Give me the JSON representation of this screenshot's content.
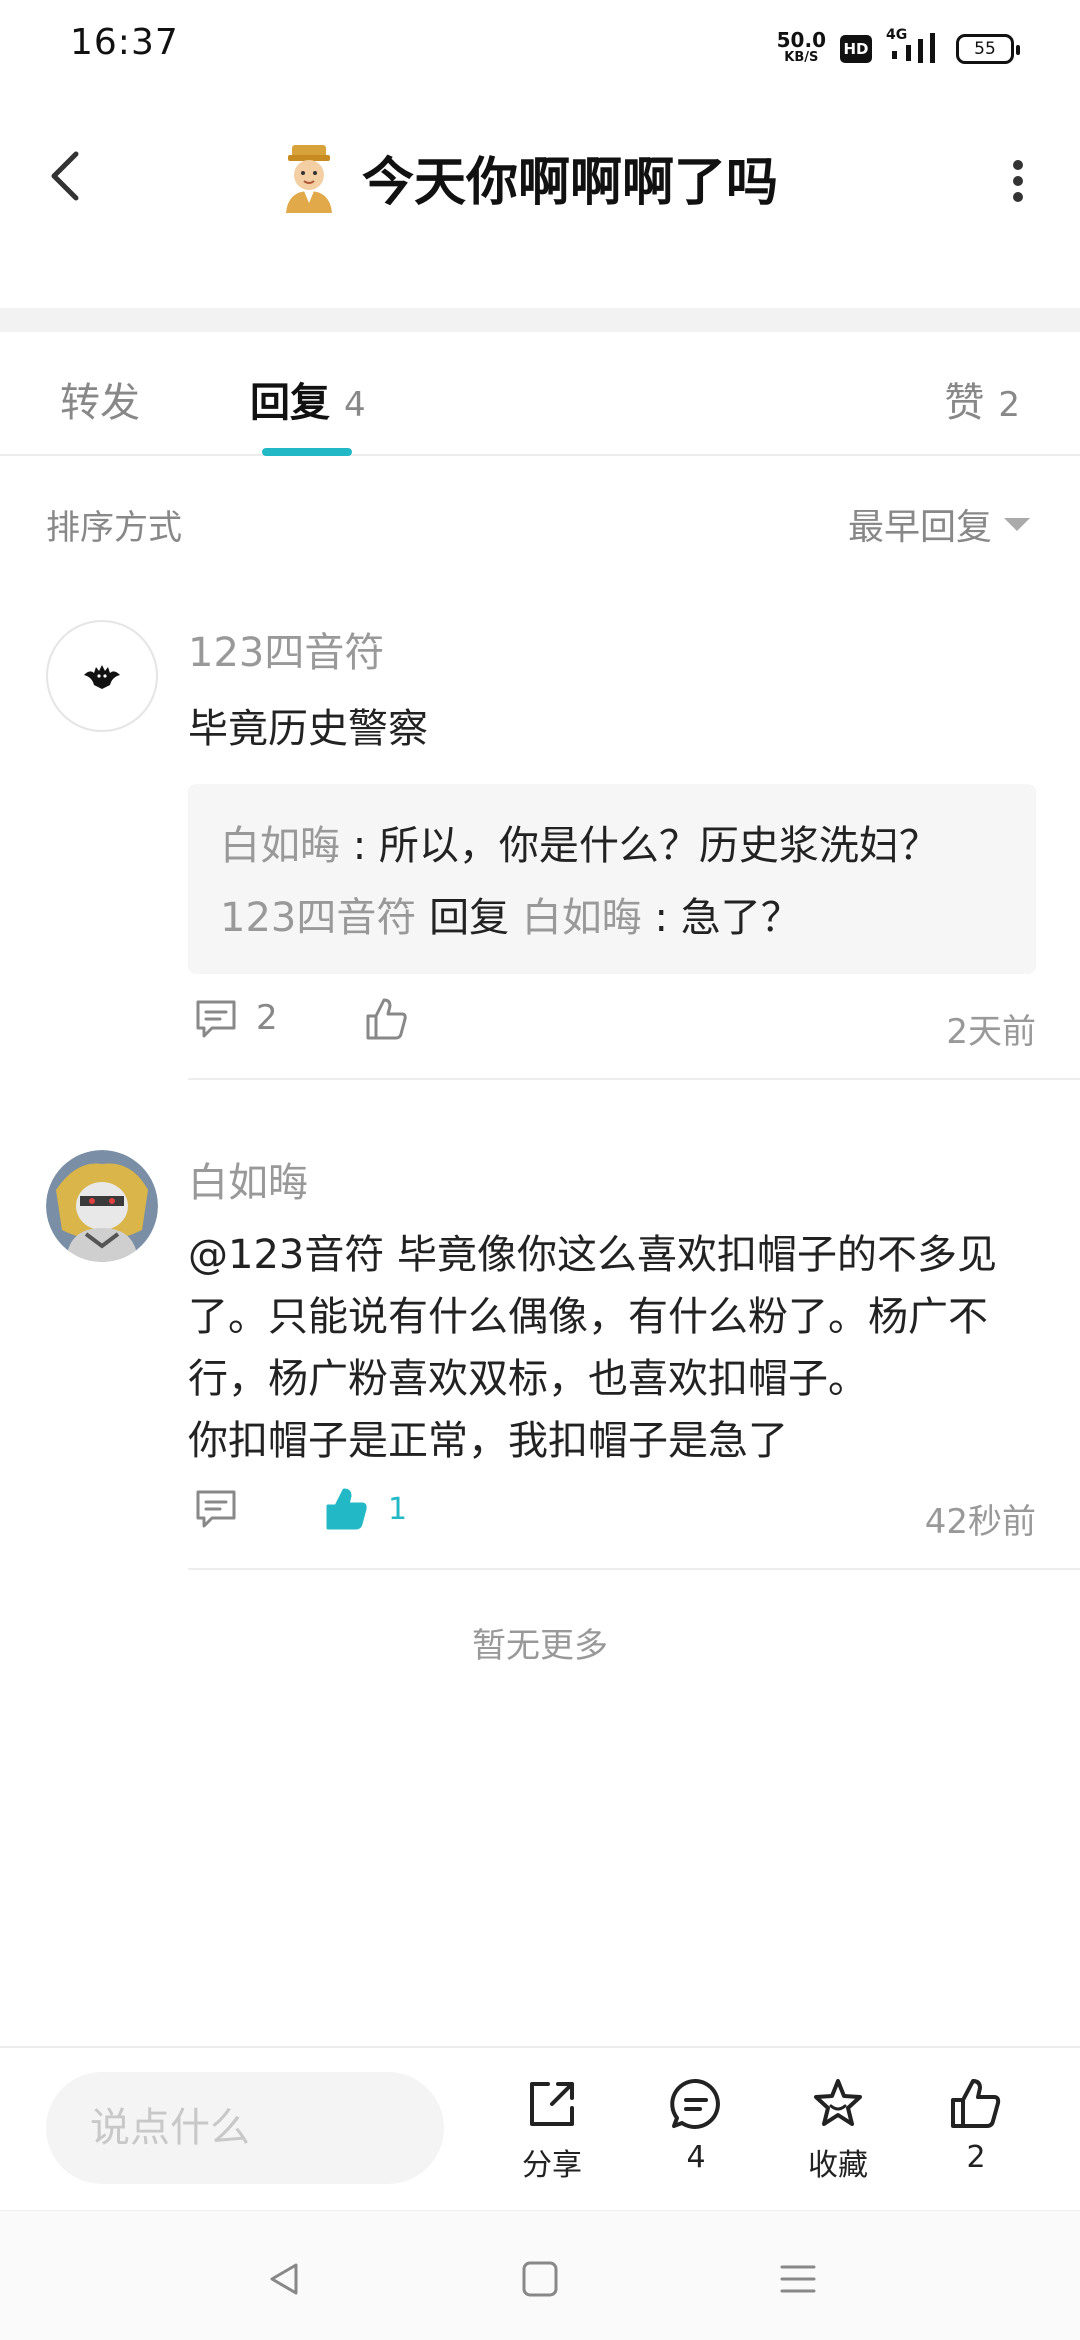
{
  "status_bar": {
    "time": "16:37",
    "speed_value": "50.0",
    "speed_unit": "KB/S",
    "hd_label": "HD",
    "network": "4G",
    "battery": "55"
  },
  "header": {
    "title": "今天你啊啊啊了吗"
  },
  "tabs": {
    "forward": "转发",
    "reply": "回复",
    "reply_count": "4",
    "like": "赞",
    "like_count": "2"
  },
  "sort": {
    "label": "排序方式",
    "value": "最早回复"
  },
  "comments": [
    {
      "name": "123四音符",
      "text": "毕竟历史警察",
      "quotes": [
        {
          "author": "白如晦",
          "sep": " : ",
          "text": "所以，你是什么？历史浆洗妇？"
        },
        {
          "author": "123四音符",
          "reply_word": "回复",
          "target": "白如晦",
          "sep": " : ",
          "text": "急了？"
        }
      ],
      "reply_count": "2",
      "time": "2天前"
    },
    {
      "name": "白如晦",
      "text_lines": [
        "@123音符  毕竟像你这么喜欢扣帽子的不多见",
        "了。只能说有什么偶像，有什么粉了。杨广不",
        "行，杨广粉喜欢双标，也喜欢扣帽子。",
        "你扣帽子是正常，我扣帽子是急了"
      ],
      "like_count": "1",
      "time": "42秒前"
    }
  ],
  "no_more": "暂无更多",
  "bottom_bar": {
    "input_placeholder": "说点什么",
    "share_label": "分享",
    "comment_count": "4",
    "favorite_label": "收藏",
    "like_count": "2"
  },
  "colors": {
    "accent": "#22b8c6",
    "text_primary": "#222222",
    "text_secondary": "#999999"
  }
}
